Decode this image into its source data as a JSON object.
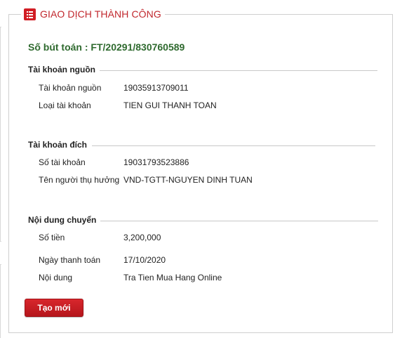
{
  "header": {
    "title": "GIAO DỊCH THÀNH CÔNG",
    "icon": "list-icon"
  },
  "reference": "Số bút toán : FT/20291/830760589",
  "source_account": {
    "title": "Tài khoản nguồn",
    "rows": [
      {
        "label": "Tài khoản nguồn",
        "value": "19035913709011"
      },
      {
        "label": "Loại tài khoản",
        "value": "TIEN GUI THANH TOAN"
      }
    ]
  },
  "destination_account": {
    "title": "Tài khoản đích",
    "rows": [
      {
        "label": "Số tài khoản",
        "value": "19031793523886"
      },
      {
        "label": "Tên người thụ hưởng",
        "value": "VND-TGTT-NGUYEN DINH TUAN"
      }
    ]
  },
  "transfer_content": {
    "title": "Nội dung chuyển",
    "rows": [
      {
        "label": "Số tiền",
        "value": "3,200,000"
      },
      {
        "label": "Ngày thanh toán",
        "value": "17/10/2020"
      },
      {
        "label": "Nội dung",
        "value": "Tra Tien Mua Hang Online"
      }
    ]
  },
  "actions": {
    "new_label": "Tạo mới"
  },
  "colors": {
    "accent": "#c1272d",
    "reference": "#2f6a2f",
    "border": "#cfcfcf"
  }
}
